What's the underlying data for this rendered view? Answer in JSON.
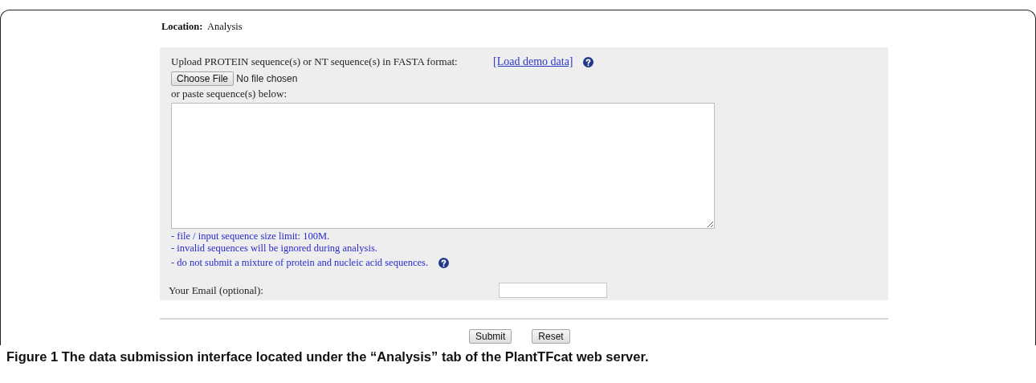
{
  "location": {
    "label": "Location:",
    "value": "Analysis"
  },
  "upload": {
    "label": "Upload PROTEIN sequence(s) or NT sequence(s) in FASTA format:",
    "demo_link": "[Load demo data]",
    "file_button": "Choose File",
    "file_status": "No file chosen",
    "paste_label": "or paste sequence(s) below:"
  },
  "notes": [
    {
      "text": "- file / input sequence size limit: 100M.",
      "help": false
    },
    {
      "text": "- invalid sequences will be ignored during analysis.",
      "help": false
    },
    {
      "text": "- do not submit a mixture of protein and nucleic acid sequences.",
      "help": true
    }
  ],
  "email": {
    "label": "Your Email (optional):"
  },
  "buttons": [
    "Submit",
    "Reset"
  ],
  "caption": "Figure 1 The data submission interface located under the “Analysis” tab of the PlantTFcat web server."
}
